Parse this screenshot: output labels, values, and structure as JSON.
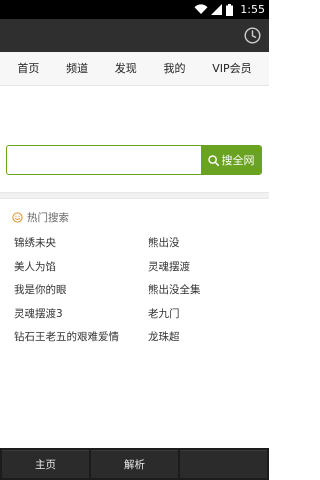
{
  "status_bar": {
    "time": "1:55",
    "icons": [
      "wifi-icon",
      "signal-icon",
      "battery-icon"
    ]
  },
  "title_bar": {
    "icon": "clock-icon"
  },
  "nav": {
    "items": [
      {
        "label": "首页"
      },
      {
        "label": "频道"
      },
      {
        "label": "发现"
      },
      {
        "label": "我的"
      },
      {
        "label": "VIP会员"
      }
    ]
  },
  "search": {
    "placeholder": "",
    "value": "",
    "button_label": "搜全网",
    "button_icon": "search-icon"
  },
  "hot_search": {
    "title": "热门搜索",
    "icon": "smile-icon",
    "items": [
      "锦绣未央",
      "熊出没",
      "美人为馅",
      "灵魂摆渡",
      "我是你的眼",
      "熊出没全集",
      "灵魂摆渡3",
      "老九门",
      "钻石王老五的艰难爱情",
      "龙珠超"
    ]
  },
  "bottom_bar": {
    "buttons": [
      {
        "label": "主页"
      },
      {
        "label": "解析"
      },
      {
        "label": ""
      }
    ]
  },
  "colors": {
    "accent": "#6aa221",
    "status_bar": "#000000",
    "title_bar": "#2f2f2f",
    "bottom_bar": "#1c1c1c"
  }
}
